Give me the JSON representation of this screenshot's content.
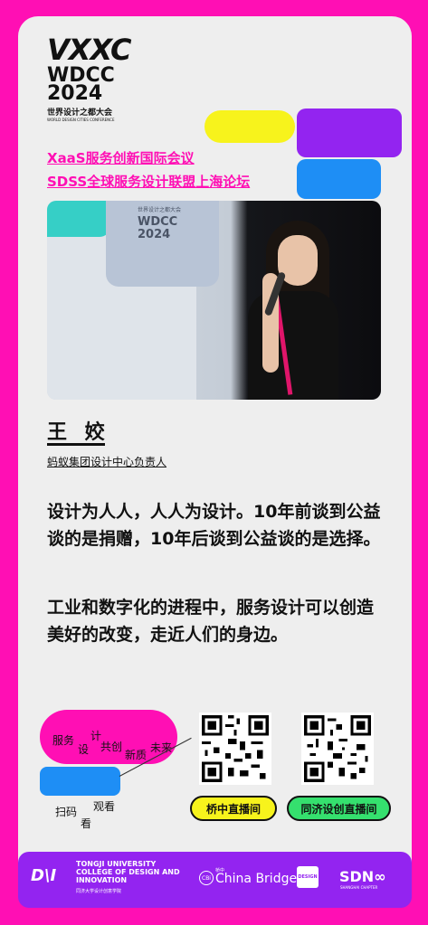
{
  "event_logo": {
    "mark": "VXXC",
    "name": "WDCC",
    "year": "2024",
    "cn_name": "世界设计之都大会",
    "en_name": "WORLD DESIGN CITIES CONFERENCE"
  },
  "conference": {
    "line1": "XaaS服务创新国际会议",
    "line2": "SDSS全球服务设计联盟上海论坛"
  },
  "photo": {
    "screen_line1": "世界设计之都大会",
    "screen_line2": "WDCC",
    "screen_line3": "2024"
  },
  "speaker": {
    "name": "王 姣",
    "role": "蚂蚁集团设计中心负责人"
  },
  "quotes": [
    "设计为人人，人人为设计。10年前谈到公益谈的是捐赠，10年后谈到公益谈的是选择。",
    "工业和数字化的进程中，服务设计可以创造美好的改变，走近人们的身边。"
  ],
  "blob_words": {
    "w1": "服务",
    "w2": "设",
    "w3": "计",
    "w4": "共创",
    "w5": "新质",
    "w6": "未来",
    "w7": "扫码",
    "w8": "观看",
    "w9": "看"
  },
  "live": {
    "btn1": "桥中直播间",
    "btn2": "同济设创直播间"
  },
  "footer": {
    "tongji_mark": "D\\I",
    "tongji_line1": "TONGJI UNIVERSITY",
    "tongji_line2": "COLLEGE OF DESIGN AND",
    "tongji_line3": "INNOVATION",
    "tongji_cn": "同济大学设计创意学院",
    "cb_icon": "CBi",
    "cb_small": "桥中",
    "cb_name": "China Bridge",
    "ds_badge": "DESIGN",
    "sd_name": "SDN∞",
    "sd_sub": "SHANGHAI CHAPTER"
  },
  "colors": {
    "background": "#ff0fb4",
    "card": "#eeeeee",
    "accent_purple": "#9324f0",
    "accent_blue": "#1e8ef5",
    "accent_yellow": "#f7f31c",
    "accent_green": "#35e06e"
  }
}
